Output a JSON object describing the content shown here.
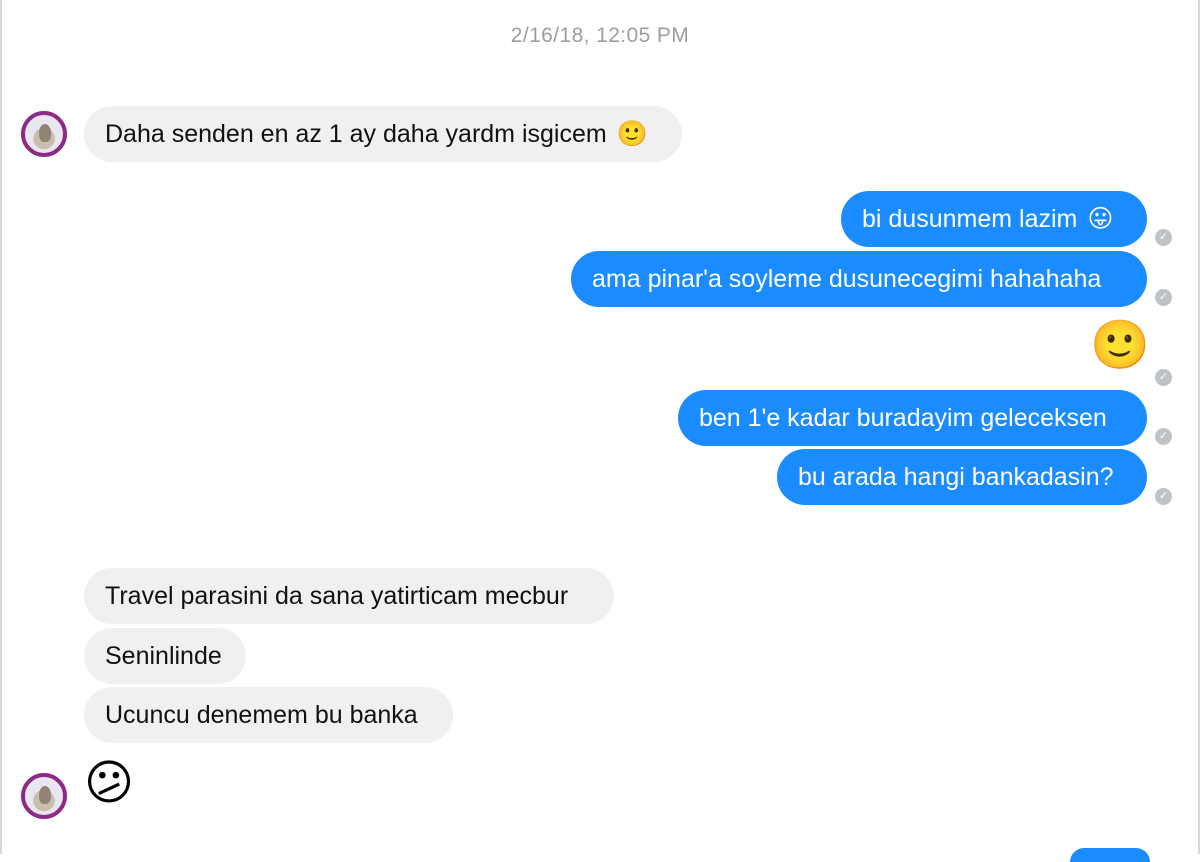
{
  "conversation": {
    "timestamp": "2/16/18, 12:05 PM",
    "messages": {
      "m1": {
        "text": "Daha senden en az 1 ay daha yardm isgicem",
        "emoji": "🙂"
      },
      "m2": {
        "text": "bi dusunmem lazim",
        "emoji": "😛"
      },
      "m3": {
        "text": "ama pinar'a soyleme dusunecegimi hahahaha"
      },
      "m4": {
        "emoji": "🙂"
      },
      "m5": {
        "text": "ben 1'e kadar buradayim geleceksen"
      },
      "m6": {
        "text": "bu arada hangi bankadasin?"
      },
      "m7": {
        "text": "Travel parasini da sana yatirticam mecbur"
      },
      "m8": {
        "text": "Seninlinde"
      },
      "m9": {
        "text": "Ucuncu denemem bu banka"
      },
      "m10": {
        "emoji": "😕"
      }
    },
    "check_glyph": "✓"
  },
  "colors": {
    "outgoing_bubble": "#1a8cff",
    "incoming_bubble": "#f1f0f0",
    "timestamp": "#9c9ea3",
    "avatar_ring": "#8a2b86"
  },
  "icons": {
    "avatar": "contact-avatar",
    "read_receipt": "sent-check-icon"
  }
}
